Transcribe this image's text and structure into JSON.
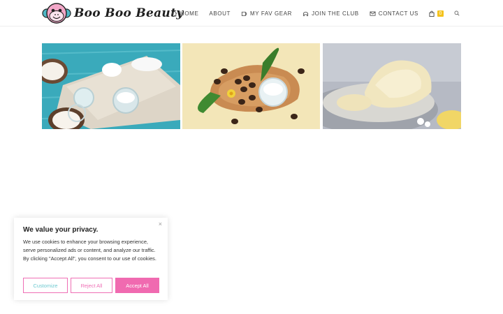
{
  "brand": {
    "name": "Boo Boo Beauty"
  },
  "nav": {
    "items": [
      {
        "label": "HOME",
        "icon": "home-icon"
      },
      {
        "label": "ABOUT",
        "icon": ""
      },
      {
        "label": "MY FAV GEAR",
        "icon": "mug-icon"
      },
      {
        "label": "JOIN THE CLUB",
        "icon": "club-icon"
      },
      {
        "label": "CONTACT US",
        "icon": "envelope-icon"
      }
    ],
    "cart_count": "0"
  },
  "gallery": {
    "images": [
      {
        "icon": "coconut-oil-image"
      },
      {
        "icon": "shea-butter-image"
      },
      {
        "icon": "butter-bowl-image"
      }
    ]
  },
  "cookie": {
    "title": "We value your privacy.",
    "text": "We use cookies to enhance your browsing experience, serve personalized ads or content, and analyze our traffic. By clicking \"Accept All\", you consent to our use of cookies.",
    "close": "×",
    "customize_label": "Customize",
    "reject_label": "Reject All",
    "accept_label": "Accept All"
  },
  "colors": {
    "accent_pink": "#f06ab0",
    "badge_yellow": "#f4c21b",
    "teal": "#6ec9d0"
  }
}
